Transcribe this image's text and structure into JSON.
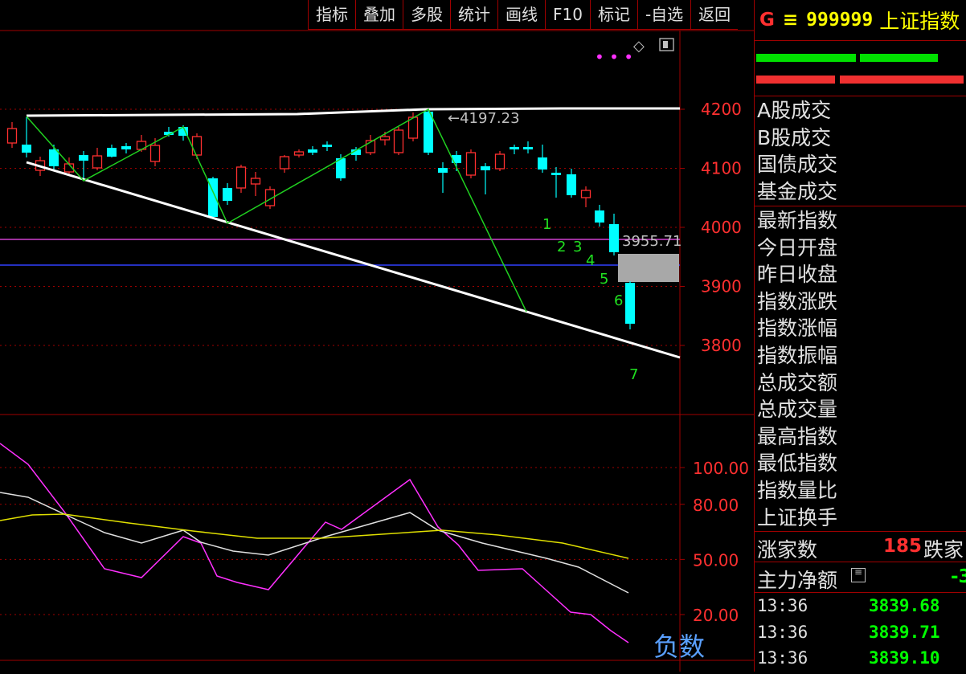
{
  "toolbar": {
    "items": [
      "指标",
      "叠加",
      "多股",
      "统计",
      "画线",
      "F10",
      "标记",
      "-自选",
      "返回"
    ]
  },
  "header": {
    "tag": "G",
    "menu_icon": "≡",
    "code": "999999",
    "name": "上证指数"
  },
  "price_axis": {
    "labels": [
      "4200",
      "4100",
      "4000",
      "3900",
      "3800"
    ]
  },
  "indicator_axis": {
    "labels": [
      "100.00",
      "80.00",
      "50.00",
      "20.00"
    ]
  },
  "annotations": {
    "high_label": "4197.23",
    "level_label": "3955.71",
    "wave_numbers": [
      "1",
      "2",
      "3",
      "4",
      "5",
      "6",
      "7"
    ]
  },
  "panel": {
    "turnover_labels": [
      "A股成交",
      "B股成交",
      "国债成交",
      "基金成交"
    ],
    "index_labels": [
      "最新指数",
      "今日开盘",
      "昨日收盘",
      "指数涨跌",
      "指数涨幅",
      "指数振幅",
      "总成交额",
      "总成交量",
      "最高指数",
      "最低指数",
      "指数量比",
      "上证换手"
    ],
    "advance": {
      "label": "涨家数",
      "value": "185",
      "decline_label": "跌家"
    },
    "main_flow": {
      "label": "主力净额",
      "value": "-3"
    },
    "ticks": [
      {
        "time": "13:36",
        "price": "3839.68"
      },
      {
        "time": "13:36",
        "price": "3839.71"
      },
      {
        "time": "13:36",
        "price": "3839.10"
      }
    ]
  },
  "watermark": "负数",
  "colors": {
    "up": "#ff3030",
    "down": "#00ffff",
    "grid": "#a00000",
    "axis_text": "#ff3030",
    "green_line": "#20d020",
    "white_line": "#ffffff",
    "magenta": "#ff30ff",
    "yellow": "#e0e000"
  }
}
